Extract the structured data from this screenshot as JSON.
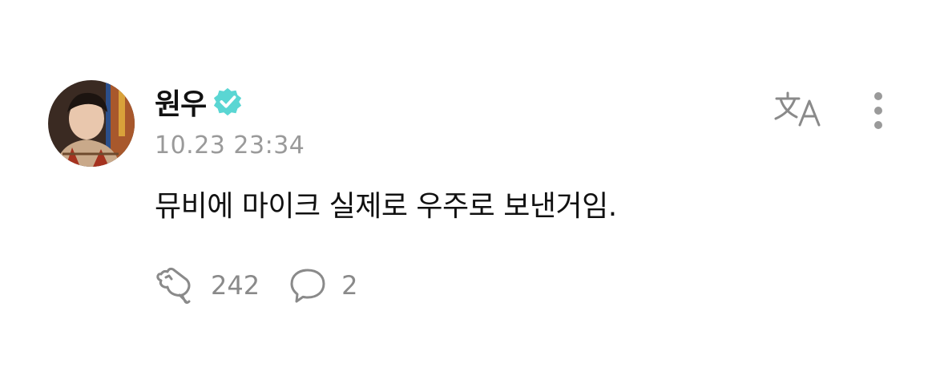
{
  "post": {
    "author": {
      "name": "원우",
      "verified": true,
      "avatar_icon": "profile-photo"
    },
    "timestamp": "10.23 23:34",
    "text": "뮤비에 마이크 실제로 우주로 보낸거임.",
    "actions": {
      "reactions": {
        "icon": "reaction-icon",
        "count": "242"
      },
      "comments": {
        "icon": "comment-icon",
        "count": "2"
      }
    },
    "header_actions": {
      "translate_icon": "translate-icon",
      "more_icon": "more-vertical-icon"
    }
  },
  "colors": {
    "verified_badge": "#5ad6d3",
    "secondary_text": "#9a9a9a",
    "icon_gray": "#8a8a8a",
    "primary_text": "#111111"
  }
}
